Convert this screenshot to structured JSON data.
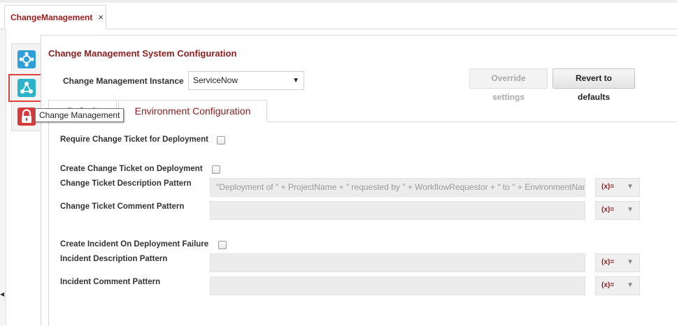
{
  "window": {
    "tab_title": "ChangeManagement",
    "tab_close": "×"
  },
  "sidebar": {
    "items": [
      {
        "icon": "settings-plugin-icon"
      },
      {
        "icon": "change-management-icon",
        "selected": true
      },
      {
        "icon": "lock-icon"
      }
    ],
    "tooltip": "Change Management"
  },
  "main": {
    "title": "Change Management System Configuration",
    "instance_label": "Change Management Instance",
    "instance_value": "ServiceNow",
    "override_label": "Override settings",
    "revert_label": "Revert to defaults",
    "tabs": [
      {
        "label": "Default"
      },
      {
        "label": "Environment Configuration",
        "active": true
      }
    ]
  },
  "form": {
    "require_ticket_label": "Require Change Ticket for Deployment",
    "create_ticket_label": "Create Change Ticket on Deployment",
    "ticket_desc_label": "Change Ticket Description Pattern",
    "ticket_desc_value": "\"Deployment of \" + ProjectName + \" requested by \" + WorkflowRequestor + \" to \" + EnvironmentName",
    "ticket_comment_label": "Change Ticket Comment Pattern",
    "ticket_comment_value": "",
    "create_incident_label": "Create Incident On Deployment Failure",
    "incident_desc_label": "Incident Description Pattern",
    "incident_desc_value": "",
    "incident_comment_label": "Incident Comment Pattern",
    "incident_comment_value": "",
    "var_glyph": "(x)="
  },
  "colors": {
    "accent": "#8b1d1d",
    "highlight": "#e0403c"
  }
}
